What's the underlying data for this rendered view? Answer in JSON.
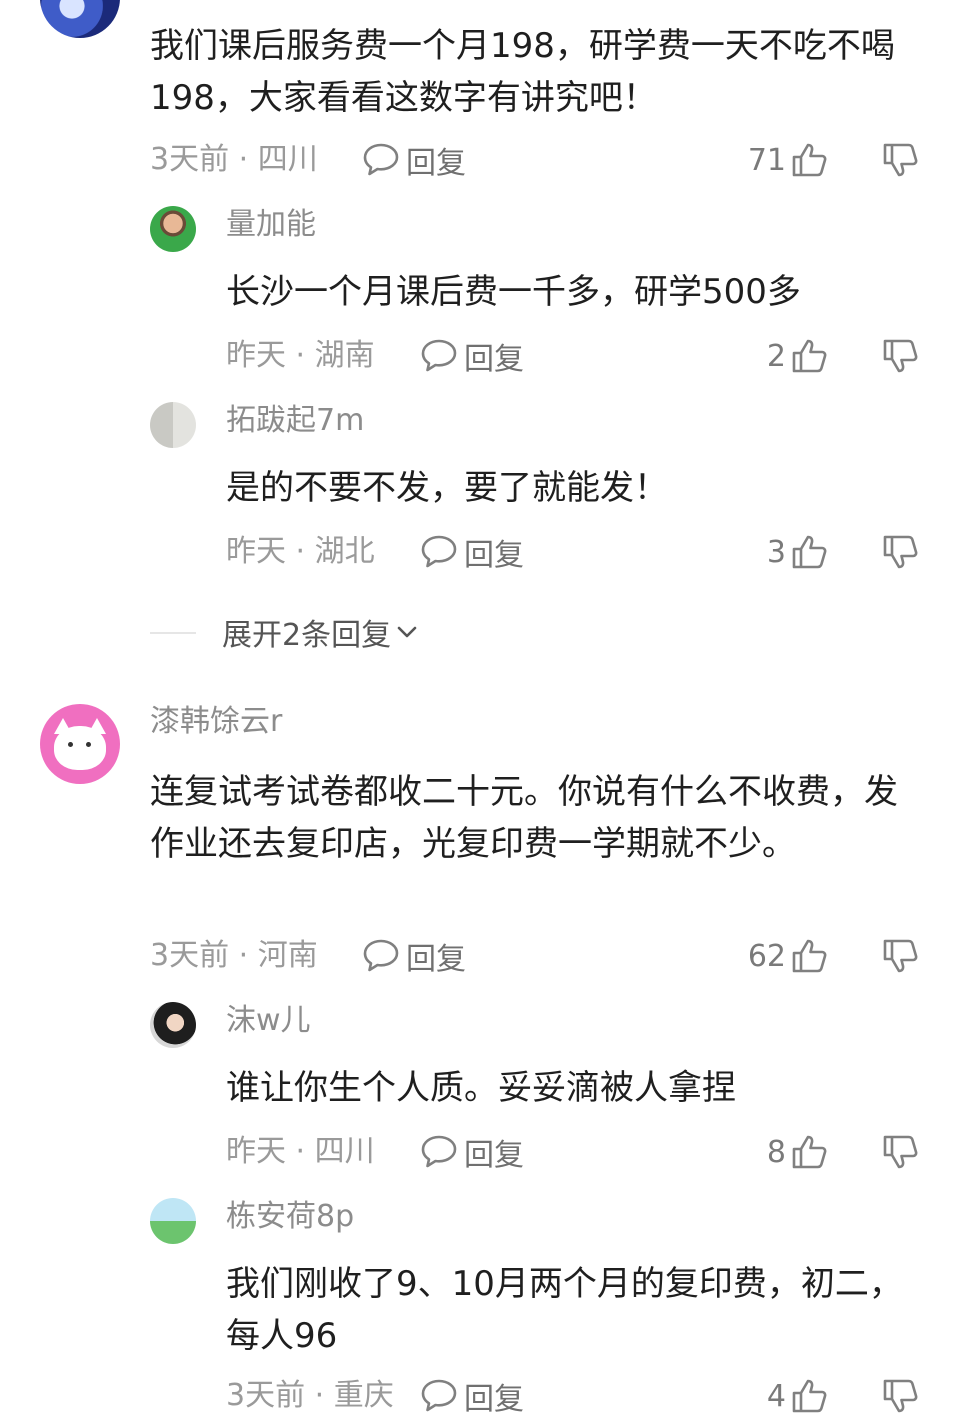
{
  "comments": [
    {
      "text": "我们课后服务费一个月198，研学费一天不吃不喝198，大家看看这数字有讲究吧！",
      "time_location": "3天前 · 四川",
      "reply_label": "回复",
      "likes": "71",
      "replies": [
        {
          "name": "量加能",
          "text": "长沙一个月课后费一千多，研学500多",
          "time_location": "昨天 · 湖南",
          "reply_label": "回复",
          "likes": "2"
        },
        {
          "name": "拓跋起7m",
          "text": "是的不要不发，要了就能发！",
          "time_location": "昨天 · 湖北",
          "reply_label": "回复",
          "likes": "3"
        }
      ],
      "expand_label": "展开2条回复"
    },
    {
      "name": "漆韩馀云r",
      "text": "连复试考试卷都收二十元。你说有什么不收费，发作业还去复印店，光复印费一学期就不少。",
      "time_location": "3天前 · 河南",
      "reply_label": "回复",
      "likes": "62",
      "replies": [
        {
          "name": "沫w儿",
          "text": "谁让你生个人质。妥妥滴被人拿捏",
          "time_location": "昨天 · 四川",
          "reply_label": "回复",
          "likes": "8"
        },
        {
          "name": "栋安荷8p",
          "text": "我们刚收了9、10月两个月的复印费，初二，每人96",
          "time_location": "3天前 · 重庆",
          "reply_label": "回复",
          "likes": "4"
        }
      ]
    }
  ],
  "icons": {
    "reply": "speech-bubble-icon",
    "like": "thumbs-up-icon",
    "dislike": "thumbs-down-icon",
    "expand": "chevron-down-icon"
  }
}
